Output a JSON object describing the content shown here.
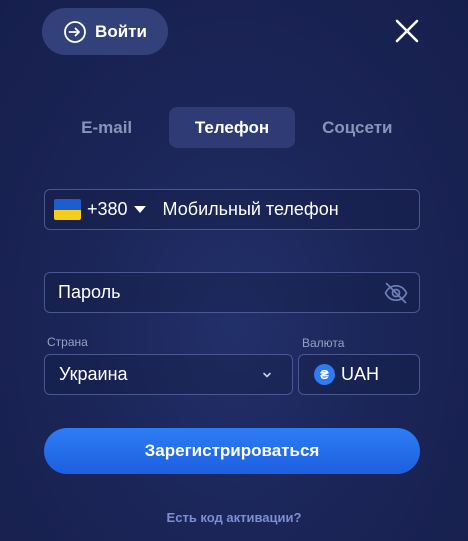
{
  "header": {
    "login_label": "Войти",
    "login_icon": "login-icon",
    "close_icon": "close-icon"
  },
  "tabs": [
    {
      "label": "E-mail",
      "active": false
    },
    {
      "label": "Телефон",
      "active": true
    },
    {
      "label": "Соцсети",
      "active": false
    }
  ],
  "phone": {
    "country_flag": "ukraine-flag-icon",
    "code": "+380",
    "placeholder": "Мобильный телефон"
  },
  "password": {
    "placeholder": "Пароль",
    "toggle_icon": "eye-off-icon"
  },
  "country": {
    "label": "Страна",
    "value": "Украина"
  },
  "currency": {
    "label": "Валюта",
    "symbol": "₴",
    "value": "UAH"
  },
  "register_label": "Зарегистрироваться",
  "activation_link": "Есть код активации?",
  "colors": {
    "background": "#1b2558",
    "accent": "#2d7df5",
    "field_border": "#4a5790"
  }
}
